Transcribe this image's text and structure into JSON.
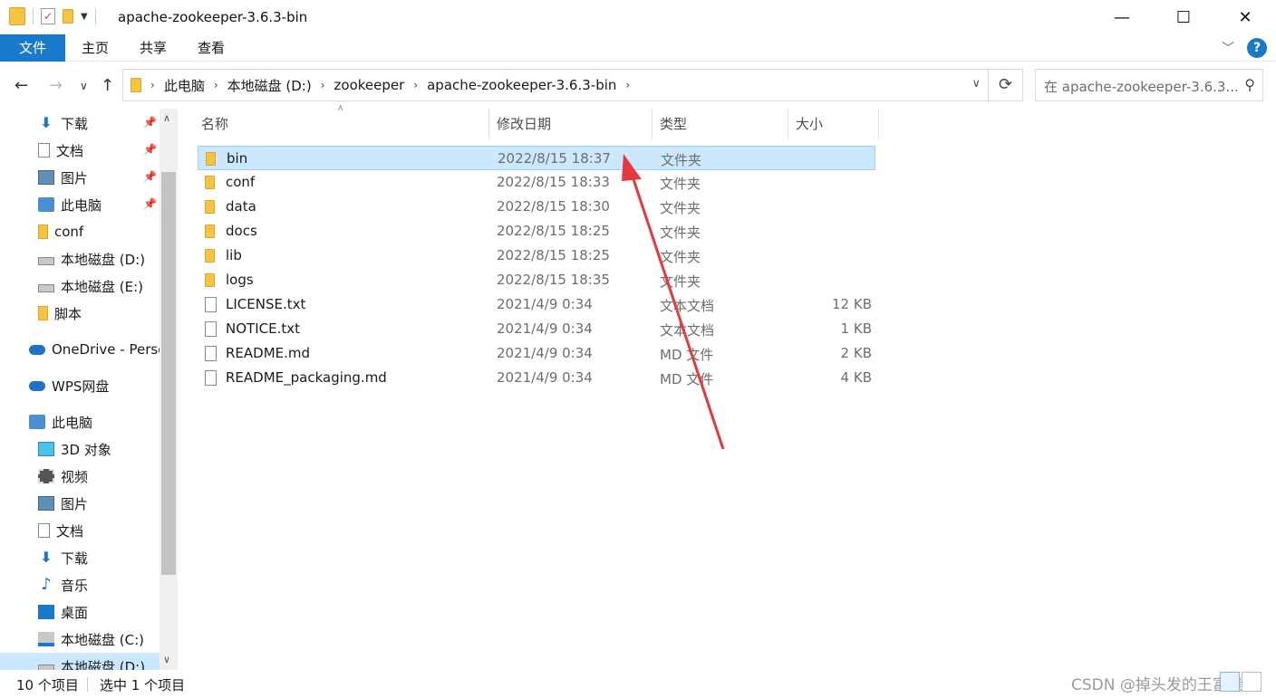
{
  "window": {
    "title": "apache-zookeeper-3.6.3-bin",
    "minimize": "—",
    "maximize": "☐",
    "close": "✕"
  },
  "ribbon": {
    "tabs": [
      "文件",
      "主页",
      "共享",
      "查看"
    ],
    "help": "?"
  },
  "address": {
    "crumbs": [
      "此电脑",
      "本地磁盘 (D:)",
      "zookeeper",
      "apache-zookeeper-3.6.3-bin"
    ],
    "search_placeholder": "在 apache-zookeeper-3.6.3..."
  },
  "nav": {
    "items": [
      {
        "label": "下载",
        "icon": "download-arrow-icon",
        "pinned": true
      },
      {
        "label": "文档",
        "icon": "document-icon",
        "pinned": true
      },
      {
        "label": "图片",
        "icon": "picture-icon",
        "pinned": true
      },
      {
        "label": "此电脑",
        "icon": "computer-icon",
        "pinned": true
      },
      {
        "label": "conf",
        "icon": "folder-icon",
        "pinned": false
      },
      {
        "label": "本地磁盘 (D:)",
        "icon": "drive-icon",
        "pinned": false
      },
      {
        "label": "本地磁盘 (E:)",
        "icon": "drive-icon",
        "pinned": false
      },
      {
        "label": "脚本",
        "icon": "folder-icon",
        "pinned": false
      },
      {
        "label": "OneDrive - Perso",
        "icon": "onedrive-cloud-icon",
        "pinned": false
      },
      {
        "label": "WPS网盘",
        "icon": "wps-cloud-icon",
        "pinned": false
      },
      {
        "label": "此电脑",
        "icon": "computer-icon",
        "pinned": false
      },
      {
        "label": "3D 对象",
        "icon": "3d-objects-icon",
        "pinned": false
      },
      {
        "label": "视频",
        "icon": "video-icon",
        "pinned": false
      },
      {
        "label": "图片",
        "icon": "picture-icon",
        "pinned": false
      },
      {
        "label": "文档",
        "icon": "document-icon",
        "pinned": false
      },
      {
        "label": "下载",
        "icon": "download-arrow-icon",
        "pinned": false
      },
      {
        "label": "音乐",
        "icon": "music-icon",
        "pinned": false
      },
      {
        "label": "桌面",
        "icon": "desktop-icon",
        "pinned": false
      },
      {
        "label": "本地磁盘 (C:)",
        "icon": "windows-drive-icon",
        "pinned": false
      },
      {
        "label": "本地磁盘 (D:)",
        "icon": "drive-icon",
        "pinned": false
      }
    ]
  },
  "columns": {
    "name": "名称",
    "date": "修改日期",
    "type": "类型",
    "size": "大小"
  },
  "files": [
    {
      "name": "bin",
      "date": "2022/8/15 18:37",
      "type": "文件夹",
      "size": "",
      "kind": "folder",
      "selected": true
    },
    {
      "name": "conf",
      "date": "2022/8/15 18:33",
      "type": "文件夹",
      "size": "",
      "kind": "folder"
    },
    {
      "name": "data",
      "date": "2022/8/15 18:30",
      "type": "文件夹",
      "size": "",
      "kind": "folder"
    },
    {
      "name": "docs",
      "date": "2022/8/15 18:25",
      "type": "文件夹",
      "size": "",
      "kind": "folder"
    },
    {
      "name": "lib",
      "date": "2022/8/15 18:25",
      "type": "文件夹",
      "size": "",
      "kind": "folder"
    },
    {
      "name": "logs",
      "date": "2022/8/15 18:35",
      "type": "文件夹",
      "size": "",
      "kind": "folder"
    },
    {
      "name": "LICENSE.txt",
      "date": "2021/4/9 0:34",
      "type": "文本文档",
      "size": "12 KB",
      "kind": "file"
    },
    {
      "name": "NOTICE.txt",
      "date": "2021/4/9 0:34",
      "type": "文本文档",
      "size": "1 KB",
      "kind": "file"
    },
    {
      "name": "README.md",
      "date": "2021/4/9 0:34",
      "type": "MD 文件",
      "size": "2 KB",
      "kind": "file"
    },
    {
      "name": "README_packaging.md",
      "date": "2021/4/9 0:34",
      "type": "MD 文件",
      "size": "4 KB",
      "kind": "file"
    }
  ],
  "status": {
    "count": "10 个项目",
    "selection": "选中 1 个项目"
  },
  "watermark": "CSDN @掉头发的王富贵",
  "colors": {
    "accent": "#1979ca",
    "selection": "#cce8ff",
    "annotation_arrow": "#e8383d"
  }
}
